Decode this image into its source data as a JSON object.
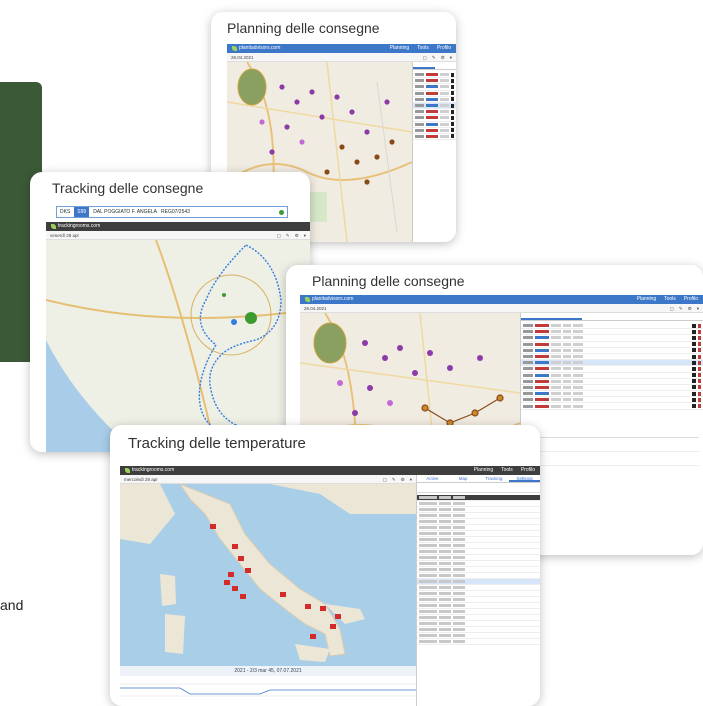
{
  "stray_text": "and",
  "cards": {
    "planning_back": {
      "title": "Planning delle consegne",
      "app_name": "planitadvisors.com",
      "date": "26.04.2021",
      "menu": [
        "Planning",
        "Tools",
        "Profilo"
      ]
    },
    "tracking_deliveries": {
      "title": "Tracking delle consegne",
      "app_name": "trackingrooms.com",
      "search_items": [
        "DKS",
        "S99",
        "DAL POGGIATO F. ANGELA",
        "REG07/2543"
      ],
      "date": "venerdì 28 apr"
    },
    "planning_front": {
      "title": "Planning delle consegne",
      "app_name": "planitadvisors.com",
      "date": "26.04.2021",
      "menu": [
        "Planning",
        "Tools",
        "Profilo"
      ]
    },
    "tracking_temperature": {
      "title": "Tracking delle temperature",
      "app_name": "trackingrooms.com",
      "date": "mercoledì 28 apr",
      "menu": [
        "Planning",
        "Tools",
        "Profilo"
      ],
      "tabs": [
        "Active",
        "Map",
        "Tracking",
        "Settings"
      ],
      "footer_date": "2021 - 2/3 mar 45, 07.07.2021"
    }
  },
  "colors": {
    "app_blue": "#3d78c8",
    "dark_bar": "#3e3e3e",
    "brand_green": "#9bd15a",
    "panel_green": "#3b5937",
    "marker_red": "#d42a2a"
  }
}
